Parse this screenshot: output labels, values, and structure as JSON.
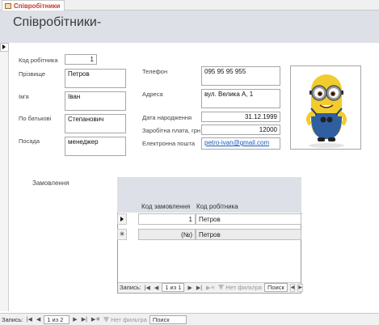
{
  "tab": {
    "title": "Співробітники"
  },
  "form": {
    "title": "Співробітники-"
  },
  "fields": {
    "employee_code": {
      "label": "Код робітника",
      "value": "1"
    },
    "surname": {
      "label": "Прізвище",
      "value": "Петров"
    },
    "first_name": {
      "label": "Ім'я",
      "value": "Іван"
    },
    "patronymic": {
      "label": "По батькові",
      "value": "Степанович"
    },
    "position": {
      "label": "Посада",
      "value": "менеджер"
    },
    "phone": {
      "label": "Телефон",
      "value": "095 95 95 955"
    },
    "address": {
      "label": "Адреса",
      "value": "вул. Велика А, 1"
    },
    "birth_date": {
      "label": "Дата народження",
      "value": "31.12.1999"
    },
    "salary": {
      "label": "Заробітна плата, грн",
      "value": "12000"
    },
    "email": {
      "label": "Електронна пошта",
      "value": "petro-ivan@gmail.com"
    }
  },
  "photo": {
    "icon": "minion-photo"
  },
  "orders": {
    "label": "Замовлення",
    "columns": [
      "Код замовлення",
      "Код робітника"
    ],
    "rows": [
      {
        "order_code": "1",
        "employee": "Петров"
      }
    ],
    "new_row": {
      "order_code": "(№)",
      "employee": "Петров"
    },
    "nav": {
      "records_label": "Запись:",
      "position": "1 из 1",
      "filter_label": "Нет фильтра",
      "search_label": "Поиск"
    }
  },
  "nav": {
    "records_label": "Запись:",
    "position": "1 из 2",
    "filter_label": "Нет фильтра",
    "search_label": "Поиск"
  },
  "colors": {
    "header_bg": "#dde0e6",
    "tab_title": "#c0392b",
    "link": "#1a5bb8"
  }
}
